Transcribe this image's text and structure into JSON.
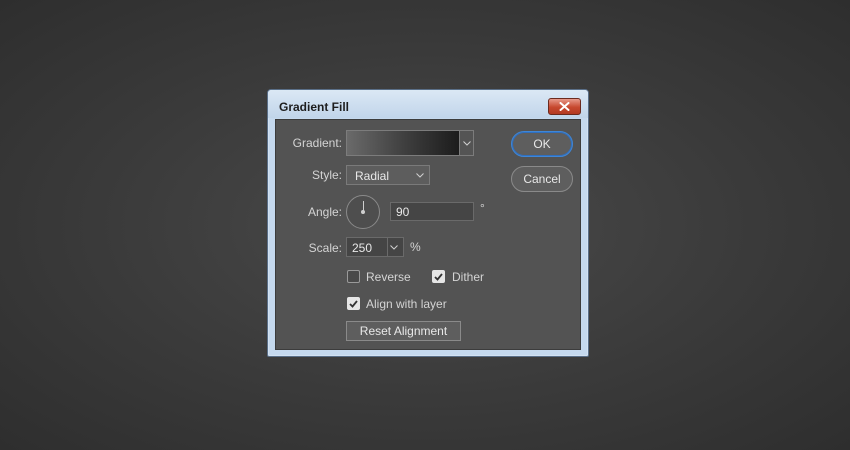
{
  "window": {
    "title": "Gradient Fill"
  },
  "form": {
    "gradient_label": "Gradient:",
    "style_label": "Style:",
    "style_value": "Radial",
    "angle_label": "Angle:",
    "angle_value": "90",
    "angle_unit": "°",
    "scale_label": "Scale:",
    "scale_value": "250",
    "scale_unit": "%",
    "reverse_label": "Reverse",
    "reverse_checked": false,
    "dither_label": "Dither",
    "dither_checked": true,
    "align_label": "Align with layer",
    "align_checked": true,
    "reset_alignment_label": "Reset Alignment"
  },
  "buttons": {
    "ok_label": "OK",
    "cancel_label": "Cancel"
  },
  "icons": {
    "close": "close-icon",
    "dropdown": "chevron-down-icon",
    "check": "checkmark-icon"
  },
  "colors": {
    "panel_bg": "#535353",
    "window_frame": "#c5d9ee",
    "close_red": "#c7482f",
    "focus_blue": "#3f86d6"
  }
}
